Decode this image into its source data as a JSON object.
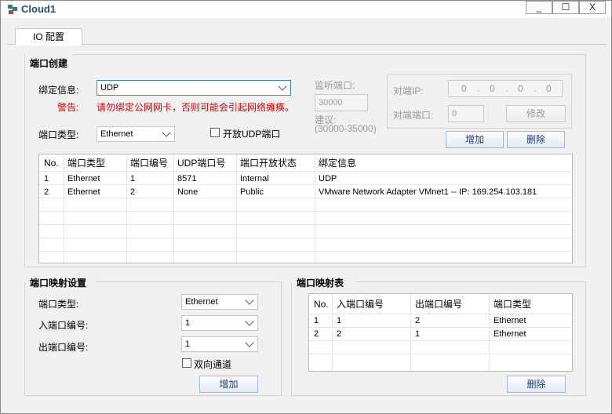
{
  "window": {
    "title": "Cloud1",
    "minimize": "_",
    "maximize": "☐",
    "close": "X"
  },
  "tabs": [
    {
      "label": "IO 配置"
    }
  ],
  "port_creation": {
    "title": "端口创建",
    "bind_label": "绑定信息:",
    "bind_value": "UDP",
    "warning_label": "警告:",
    "warning_text": "请勿绑定公网网卡，否则可能会引起网络瘫痪。",
    "port_type_label": "端口类型:",
    "port_type_value": "Ethernet",
    "open_udp_label": "开放UDP端口",
    "listen_port_label": "监听端口:",
    "listen_port_value": "30000",
    "suggest_label": "建议:",
    "suggest_range": "(30000-35000)",
    "peer_ip_label": "对端IP:",
    "peer_ip_value": [
      "0",
      "0",
      "0",
      "0"
    ],
    "peer_port_label": "对端端口:",
    "peer_port_value": "0",
    "modify_button": "修改",
    "add_button": "增加",
    "delete_button": "删除",
    "table": {
      "headers": [
        "No.",
        "端口类型",
        "端口编号",
        "UDP端口号",
        "端口开放状态",
        "绑定信息"
      ],
      "rows": [
        [
          "1",
          "Ethernet",
          "1",
          "8571",
          "Internal",
          "UDP"
        ],
        [
          "2",
          "Ethernet",
          "2",
          "None",
          "Public",
          "VMware Network Adapter VMnet1 -- IP: 169.254.103.181"
        ]
      ]
    }
  },
  "port_mapping_settings": {
    "title": "端口映射设置",
    "port_type_label": "端口类型:",
    "port_type_value": "Ethernet",
    "in_port_label": "入端口编号:",
    "in_port_value": "1",
    "out_port_label": "出端口编号:",
    "out_port_value": "1",
    "bidirectional_label": "双向通道",
    "add_button": "增加"
  },
  "port_mapping_table": {
    "title": "端口映射表",
    "headers": [
      "No.",
      "入端口编号",
      "出端口编号",
      "端口类型"
    ],
    "rows": [
      [
        "1",
        "1",
        "2",
        "Ethernet"
      ],
      [
        "2",
        "2",
        "1",
        "Ethernet"
      ]
    ],
    "delete_button": "删除"
  }
}
